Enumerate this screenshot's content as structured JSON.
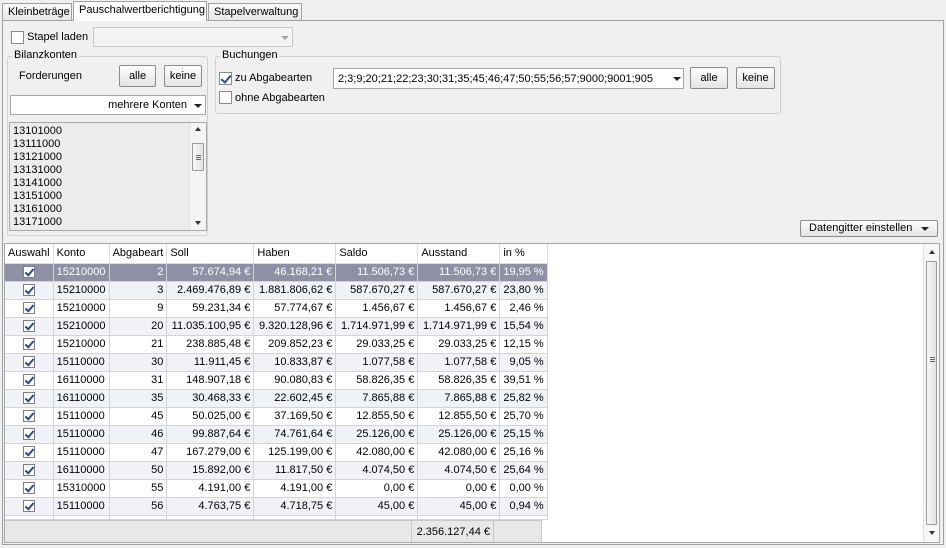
{
  "tabs": [
    {
      "label": "Kleinbeträge"
    },
    {
      "label": "Pauschalwertberichtigung"
    },
    {
      "label": "Stapelverwaltung"
    }
  ],
  "stapel": {
    "label": "Stapel laden",
    "checked": false,
    "combo_value": ""
  },
  "bilanzkonten": {
    "title": "Bilanzkonten",
    "row_label": "Forderungen",
    "alle_label": "alle",
    "keine_label": "keine",
    "combo_value": "mehrere Konten",
    "accounts": [
      "13101000",
      "13111000",
      "13121000",
      "13131000",
      "13141000",
      "13151000",
      "13161000",
      "13171000"
    ]
  },
  "buchungen": {
    "title": "Buchungen",
    "zu_label": "zu Abgabearten",
    "zu_checked": true,
    "ohne_label": "ohne Abgabearten",
    "ohne_checked": false,
    "codes_value": "2;3;9;20;21;22;23;30;31;35;45;46;47;50;55;56;57;9000;9001;905",
    "alle_label": "alle",
    "keine_label": "keine"
  },
  "datagrid_button": "Datengitter einstellen",
  "grid": {
    "columns": [
      "Auswahl",
      "Konto",
      "Abgabeart",
      "Soll",
      "Haben",
      "Saldo",
      "Ausstand",
      "in %"
    ],
    "rows": [
      [
        "15210000",
        "2",
        "57.674,94 €",
        "46.168,21 €",
        "11.506,73 €",
        "11.506,73 €",
        "19,95 %"
      ],
      [
        "15210000",
        "3",
        "2.469.476,89 €",
        "1.881.806,62 €",
        "587.670,27 €",
        "587.670,27 €",
        "23,80 %"
      ],
      [
        "15210000",
        "9",
        "59.231,34 €",
        "57.774,67 €",
        "1.456,67 €",
        "1.456,67 €",
        "2,46 %"
      ],
      [
        "15210000",
        "20",
        "11.035.100,95 €",
        "9.320.128,96 €",
        "1.714.971,99 €",
        "1.714.971,99 €",
        "15,54 %"
      ],
      [
        "15210000",
        "21",
        "238.885,48 €",
        "209.852,23 €",
        "29.033,25 €",
        "29.033,25 €",
        "12,15 %"
      ],
      [
        "15110000",
        "30",
        "11.911,45 €",
        "10.833,87 €",
        "1.077,58 €",
        "1.077,58 €",
        "9,05 %"
      ],
      [
        "16110000",
        "31",
        "148.907,18 €",
        "90.080,83 €",
        "58.826,35 €",
        "58.826,35 €",
        "39,51 %"
      ],
      [
        "16110000",
        "35",
        "30.468,33 €",
        "22.602,45 €",
        "7.865,88 €",
        "7.865,88 €",
        "25,82 %"
      ],
      [
        "15110000",
        "45",
        "50.025,00 €",
        "37.169,50 €",
        "12.855,50 €",
        "12.855,50 €",
        "25,70 %"
      ],
      [
        "15110000",
        "46",
        "99.887,64 €",
        "74.761,64 €",
        "25.126,00 €",
        "25.126,00 €",
        "25,15 %"
      ],
      [
        "15110000",
        "47",
        "167.279,00 €",
        "125.199,00 €",
        "42.080,00 €",
        "42.080,00 €",
        "25,16 %"
      ],
      [
        "16110000",
        "50",
        "15.892,00 €",
        "11.817,50 €",
        "4.074,50 €",
        "4.074,50 €",
        "25,64 %"
      ],
      [
        "15310000",
        "55",
        "4.191,00 €",
        "4.191,00 €",
        "0,00 €",
        "0,00 €",
        "0,00 %"
      ],
      [
        "15110000",
        "56",
        "4.763,75 €",
        "4.718,75 €",
        "45,00 €",
        "45,00 €",
        "0,94 %"
      ]
    ],
    "total_ausstand": "2.356.127,44 €"
  }
}
